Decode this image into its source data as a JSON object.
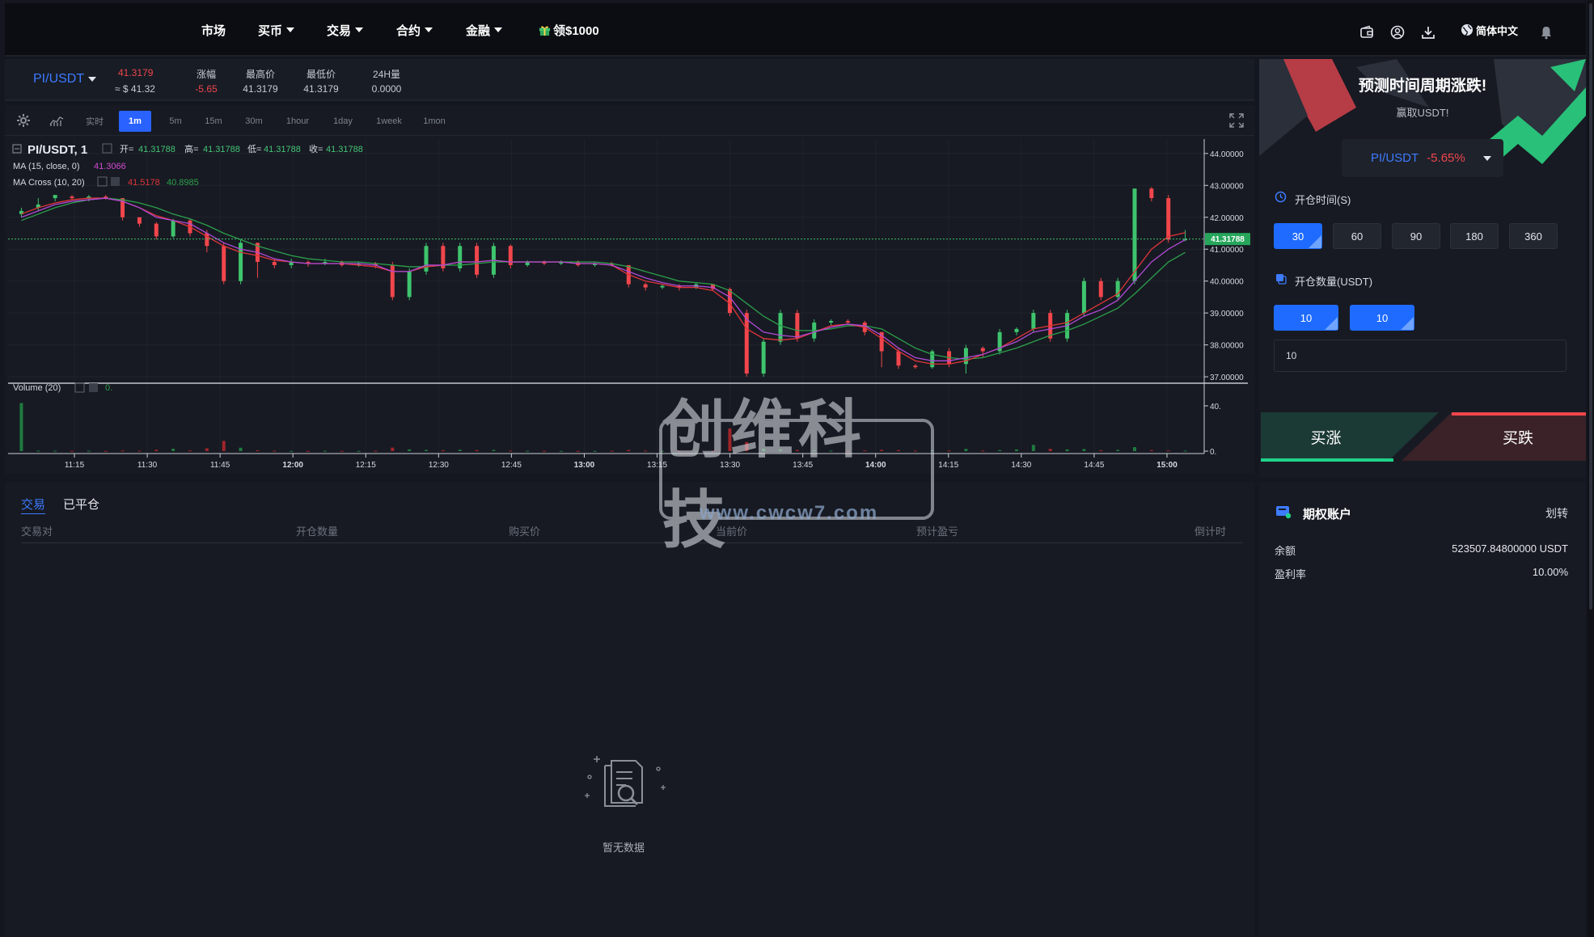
{
  "nav": {
    "items": [
      {
        "label": "市场",
        "caret": false
      },
      {
        "label": "买币",
        "caret": true
      },
      {
        "label": "交易",
        "caret": true
      },
      {
        "label": "合约",
        "caret": true
      },
      {
        "label": "金融",
        "caret": true
      }
    ],
    "promo": "领$1000",
    "language": "简体中文"
  },
  "ticker": {
    "pair": "PI/USDT",
    "price": "41.3179",
    "price_usd": "≈ $ 41.32",
    "change_label": "涨幅",
    "change_value": "-5.65",
    "high_label": "最高价",
    "high_value": "41.3179",
    "low_label": "最低价",
    "low_value": "41.3179",
    "vol_label": "24H量",
    "vol_value": "0.0000"
  },
  "chart_toolbar": {
    "timeframes": [
      "实时",
      "1m",
      "5m",
      "15m",
      "30m",
      "1hour",
      "1day",
      "1week",
      "1mon"
    ],
    "active": "1m"
  },
  "chart_legend": {
    "symbol": "PI/USDT, 1",
    "open_label": "开=",
    "open": "41.31788",
    "high_label": "高=",
    "high": "41.31788",
    "low_label": "低=",
    "low": "41.31788",
    "close_label": "收=",
    "close": "41.31788",
    "ma_label": "MA (15, close, 0)",
    "ma_value": "41.3066",
    "macross_label": "MA Cross (10, 20)",
    "macross_v1": "41.5178",
    "macross_v2": "40.8985",
    "volume_label": "Volume (20)",
    "volume_value": "0."
  },
  "chart_data": {
    "type": "candlestick",
    "x_ticks": [
      "11:15",
      "11:30",
      "11:45",
      "12:00",
      "12:15",
      "12:30",
      "12:45",
      "13:00",
      "13:15",
      "13:30",
      "13:45",
      "14:00",
      "14:15",
      "14:30",
      "14:45",
      "15:00"
    ],
    "y_ticks": [
      "44.00000",
      "43.00000",
      "42.00000",
      "41.00000",
      "40.00000",
      "39.00000",
      "38.00000",
      "37.00000"
    ],
    "ylim": [
      36.9,
      44.3
    ],
    "last_price_label": "41.31788",
    "last_price": 41.31788,
    "volume_ticks": [
      "40.",
      "0."
    ],
    "volume_max": 50,
    "candles": [
      [
        42.1,
        42.2,
        42.0,
        42.3,
        42.5
      ],
      [
        42.3,
        42.4,
        42.2,
        42.6,
        0.4
      ],
      [
        42.6,
        42.7,
        42.5,
        42.65,
        0.3
      ],
      [
        42.65,
        42.6,
        42.55,
        42.7,
        0.2
      ],
      [
        42.6,
        42.65,
        42.5,
        42.7,
        0.3
      ],
      [
        42.65,
        42.6,
        42.55,
        42.7,
        0.2
      ],
      [
        42.6,
        42.0,
        41.9,
        42.6,
        0.5
      ],
      [
        42.0,
        41.8,
        41.7,
        42.0,
        0.4
      ],
      [
        41.8,
        41.4,
        41.3,
        41.85,
        1.2
      ],
      [
        41.4,
        41.9,
        41.35,
        41.95,
        2.1
      ],
      [
        41.9,
        41.5,
        41.4,
        41.95,
        0.6
      ],
      [
        41.5,
        41.1,
        40.9,
        41.6,
        2.5
      ],
      [
        41.1,
        40.0,
        39.9,
        41.2,
        9.0
      ],
      [
        40.0,
        41.2,
        39.9,
        41.3,
        3.0
      ],
      [
        41.2,
        40.6,
        40.1,
        41.2,
        0.8
      ],
      [
        40.6,
        40.5,
        40.4,
        40.7,
        0.3
      ],
      [
        40.5,
        40.6,
        40.4,
        40.7,
        0.2
      ],
      [
        40.6,
        40.55,
        40.45,
        40.65,
        0.2
      ],
      [
        40.55,
        40.6,
        40.5,
        40.7,
        0.3
      ],
      [
        40.6,
        40.5,
        40.45,
        40.65,
        0.2
      ],
      [
        40.5,
        40.55,
        40.45,
        40.6,
        0.2
      ],
      [
        40.55,
        40.5,
        40.4,
        40.6,
        0.3
      ],
      [
        40.5,
        39.5,
        39.4,
        40.6,
        3.1
      ],
      [
        39.5,
        40.3,
        39.4,
        40.4,
        1.5
      ],
      [
        40.3,
        41.1,
        40.2,
        41.2,
        1.1
      ],
      [
        41.1,
        40.4,
        40.3,
        41.2,
        0.8
      ],
      [
        40.4,
        41.1,
        40.3,
        41.2,
        1.2
      ],
      [
        41.1,
        40.2,
        40.1,
        41.2,
        0.9
      ],
      [
        40.2,
        41.1,
        40.1,
        41.2,
        1.0
      ],
      [
        41.1,
        40.5,
        40.4,
        41.15,
        0.5
      ],
      [
        40.5,
        40.6,
        40.45,
        40.65,
        0.3
      ],
      [
        40.6,
        40.55,
        40.5,
        40.65,
        0.2
      ],
      [
        40.55,
        40.6,
        40.5,
        40.65,
        0.2
      ],
      [
        40.6,
        40.5,
        40.45,
        40.65,
        0.2
      ],
      [
        40.5,
        40.55,
        40.45,
        40.6,
        0.2
      ],
      [
        40.55,
        40.5,
        40.45,
        40.6,
        0.3
      ],
      [
        40.5,
        39.9,
        39.8,
        40.5,
        1.0
      ],
      [
        39.9,
        39.8,
        39.7,
        39.95,
        0.4
      ],
      [
        39.8,
        39.85,
        39.75,
        39.9,
        0.3
      ],
      [
        39.85,
        39.8,
        39.7,
        39.9,
        0.3
      ],
      [
        39.8,
        39.9,
        39.75,
        39.95,
        0.2
      ],
      [
        39.9,
        39.75,
        39.7,
        39.9,
        0.3
      ],
      [
        39.75,
        39.0,
        38.9,
        39.8,
        20.0
      ],
      [
        39.0,
        37.1,
        37.0,
        39.1,
        8.0
      ],
      [
        37.1,
        38.1,
        37.0,
        38.2,
        2.0
      ],
      [
        38.1,
        39.0,
        38.0,
        39.1,
        1.5
      ],
      [
        39.0,
        38.2,
        38.1,
        39.1,
        1.0
      ],
      [
        38.2,
        38.7,
        38.1,
        38.8,
        0.8
      ],
      [
        38.7,
        38.75,
        38.6,
        38.8,
        0.4
      ],
      [
        38.75,
        38.7,
        38.65,
        38.8,
        0.3
      ],
      [
        38.7,
        38.4,
        38.3,
        38.75,
        0.6
      ],
      [
        38.4,
        37.8,
        37.3,
        38.4,
        1.1
      ],
      [
        37.8,
        37.35,
        37.25,
        37.9,
        0.9
      ],
      [
        37.35,
        37.3,
        37.25,
        37.4,
        0.4
      ],
      [
        37.3,
        37.8,
        37.25,
        37.85,
        0.7
      ],
      [
        37.8,
        37.4,
        37.3,
        37.9,
        0.6
      ],
      [
        37.4,
        37.9,
        37.1,
        38.0,
        2.0
      ],
      [
        37.9,
        37.8,
        37.6,
        37.95,
        0.5
      ],
      [
        37.8,
        38.4,
        37.7,
        38.5,
        0.9
      ],
      [
        38.4,
        38.5,
        38.3,
        38.55,
        1.5
      ],
      [
        38.5,
        39.0,
        38.4,
        39.1,
        5.5
      ],
      [
        39.0,
        38.2,
        38.1,
        39.1,
        2.0
      ],
      [
        38.2,
        39.0,
        38.1,
        39.1,
        1.5
      ],
      [
        39.0,
        40.0,
        38.9,
        40.1,
        1.8
      ],
      [
        40.0,
        39.5,
        39.4,
        40.1,
        0.8
      ],
      [
        39.5,
        40.0,
        39.4,
        40.1,
        1.1
      ],
      [
        40.0,
        42.9,
        39.9,
        42.9,
        3.5
      ],
      [
        42.9,
        42.6,
        42.5,
        42.95,
        0.9
      ],
      [
        42.6,
        41.3,
        41.2,
        42.7,
        0.6
      ],
      [
        41.3,
        41.32,
        41.25,
        41.6,
        0.4
      ]
    ],
    "ma_line": [
      42.0,
      42.2,
      42.4,
      42.5,
      42.55,
      42.6,
      42.5,
      42.3,
      42.0,
      41.9,
      41.8,
      41.5,
      41.2,
      41.0,
      40.9,
      40.7,
      40.6,
      40.55,
      40.55,
      40.55,
      40.55,
      40.5,
      40.3,
      40.3,
      40.5,
      40.5,
      40.6,
      40.6,
      40.65,
      40.6,
      40.6,
      40.6,
      40.6,
      40.55,
      40.55,
      40.5,
      40.3,
      40.1,
      39.95,
      39.85,
      39.85,
      39.8,
      39.5,
      38.8,
      38.4,
      38.3,
      38.25,
      38.4,
      38.55,
      38.65,
      38.6,
      38.3,
      37.9,
      37.6,
      37.5,
      37.5,
      37.6,
      37.7,
      37.9,
      38.1,
      38.4,
      38.5,
      38.6,
      38.9,
      39.1,
      39.4,
      40.0,
      40.6,
      41.0,
      41.3
    ],
    "macross_fast": [
      42.1,
      42.3,
      42.45,
      42.55,
      42.6,
      42.6,
      42.5,
      42.3,
      42.05,
      41.9,
      41.7,
      41.4,
      41.1,
      40.9,
      40.8,
      40.65,
      40.6,
      40.55,
      40.55,
      40.55,
      40.5,
      40.45,
      40.3,
      40.3,
      40.45,
      40.5,
      40.6,
      40.6,
      40.65,
      40.6,
      40.6,
      40.6,
      40.6,
      40.55,
      40.55,
      40.5,
      40.2,
      40.0,
      39.9,
      39.8,
      39.8,
      39.7,
      39.3,
      38.5,
      38.2,
      38.15,
      38.2,
      38.4,
      38.6,
      38.65,
      38.55,
      38.2,
      37.8,
      37.5,
      37.4,
      37.4,
      37.5,
      37.7,
      37.9,
      38.2,
      38.5,
      38.6,
      38.7,
      39.0,
      39.3,
      39.6,
      40.3,
      41.0,
      41.4,
      41.52
    ],
    "macross_slow": [
      41.9,
      42.1,
      42.3,
      42.45,
      42.55,
      42.6,
      42.55,
      42.45,
      42.3,
      42.1,
      41.95,
      41.75,
      41.5,
      41.3,
      41.1,
      40.95,
      40.8,
      40.7,
      40.65,
      40.6,
      40.6,
      40.55,
      40.5,
      40.45,
      40.45,
      40.5,
      40.5,
      40.55,
      40.6,
      40.6,
      40.6,
      40.6,
      40.6,
      40.6,
      40.6,
      40.55,
      40.45,
      40.3,
      40.15,
      40.0,
      39.95,
      39.9,
      39.7,
      39.3,
      38.9,
      38.6,
      38.45,
      38.45,
      38.5,
      38.6,
      38.6,
      38.5,
      38.2,
      37.9,
      37.7,
      37.6,
      37.55,
      37.6,
      37.75,
      37.9,
      38.1,
      38.3,
      38.45,
      38.65,
      38.9,
      39.15,
      39.6,
      40.1,
      40.6,
      40.9
    ]
  },
  "trade_panel": {
    "title": "预测时间周期涨跌!",
    "subtitle": "赢取USDT!",
    "pair": "PI/USDT",
    "change": "-5.65%",
    "time_label": "开仓时间(S)",
    "times": [
      "30",
      "60",
      "90",
      "180",
      "360"
    ],
    "time_selected": "30",
    "amount_label": "开仓数量(USDT)",
    "amounts": [
      "10",
      "10"
    ],
    "amount_input": "10",
    "buy_up": "买涨",
    "buy_down": "买跌",
    "colors": {
      "up": "#1fd28a",
      "down": "#f0464c",
      "accent": "#1f6bff"
    }
  },
  "orders": {
    "tabs": [
      "交易",
      "已平仓"
    ],
    "active_tab": "交易",
    "columns": [
      "交易对",
      "开仓数量",
      "购买价",
      "当前价",
      "预计盈亏",
      "倒计时"
    ],
    "empty_text": "暂无数据"
  },
  "account": {
    "title": "期权账户",
    "transfer": "划转",
    "balance_label": "余额",
    "balance_value": "523507.84800000 USDT",
    "rate_label": "盈利率",
    "rate_value": "10.00%"
  },
  "watermark": {
    "text": "创维科技",
    "url": "www.cwcw7.com"
  }
}
